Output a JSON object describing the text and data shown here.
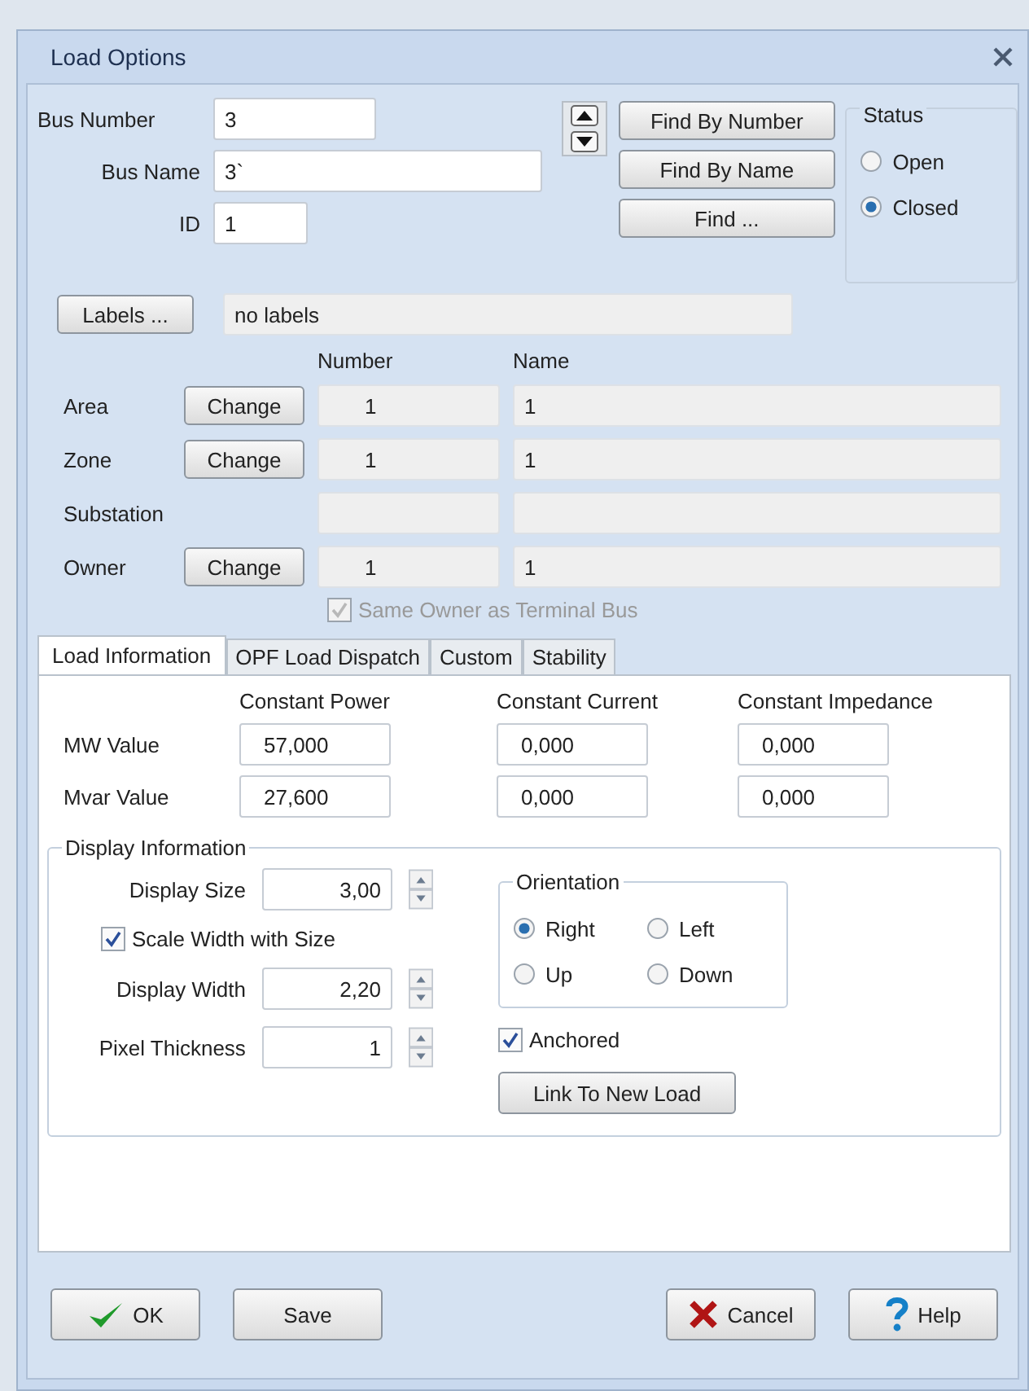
{
  "window": {
    "title": "Load Options"
  },
  "bus": {
    "number_label": "Bus Number",
    "number": "3",
    "name_label": "Bus Name",
    "name": "3`",
    "id_label": "ID",
    "id": "1"
  },
  "find_buttons": [
    "Find By Number",
    "Find By Name",
    "Find ..."
  ],
  "status": {
    "title": "Status",
    "options": [
      {
        "label": "Open",
        "selected": false
      },
      {
        "label": "Closed",
        "selected": true
      }
    ]
  },
  "labels": {
    "button": "Labels ...",
    "value": "no labels"
  },
  "ownership": {
    "number_header": "Number",
    "name_header": "Name",
    "rows": [
      {
        "label": "Area",
        "button": "Change",
        "number": "1",
        "name": "1"
      },
      {
        "label": "Zone",
        "button": "Change",
        "number": "1",
        "name": "1"
      },
      {
        "label": "Substation"
      },
      {
        "label": "Owner",
        "button": "Change",
        "number": "1",
        "name": "1"
      }
    ]
  },
  "same_owner": {
    "label": "Same Owner as Terminal Bus",
    "checked": true,
    "disabled": true
  },
  "tabs": [
    {
      "label": "Load Information",
      "selected": true
    },
    {
      "label": "OPF Load Dispatch",
      "selected": false
    },
    {
      "label": "Custom",
      "selected": false
    },
    {
      "label": "Stability",
      "selected": false
    }
  ],
  "load_information": {
    "columns": [
      "Constant Power",
      "Constant Current",
      "Constant Impedance"
    ],
    "rows": [
      {
        "label": "MW Value",
        "values": [
          "57,000",
          "0,000",
          "0,000"
        ]
      },
      {
        "label": "Mvar Value",
        "values": [
          "27,600",
          "0,000",
          "0,000"
        ]
      }
    ]
  },
  "display_information": {
    "title": "Display Information",
    "display_size": {
      "label": "Display Size",
      "value": "3,00"
    },
    "scale_width": {
      "label": "Scale Width with Size",
      "checked": true
    },
    "display_width": {
      "label": "Display Width",
      "value": "2,20"
    },
    "pixel_thickness": {
      "label": "Pixel Thickness",
      "value": "1"
    },
    "orientation": {
      "title": "Orientation",
      "options": [
        {
          "label": "Right",
          "selected": true
        },
        {
          "label": "Left",
          "selected": false
        },
        {
          "label": "Up",
          "selected": false
        },
        {
          "label": "Down",
          "selected": false
        }
      ]
    },
    "anchored": {
      "label": "Anchored",
      "checked": true
    },
    "link_button": "Link To New Load"
  },
  "buttons": [
    {
      "kind": "ok",
      "label": "OK"
    },
    {
      "kind": "save",
      "label": "Save"
    },
    {
      "kind": "cancel",
      "label": "Cancel"
    },
    {
      "kind": "help",
      "label": "Help"
    }
  ]
}
